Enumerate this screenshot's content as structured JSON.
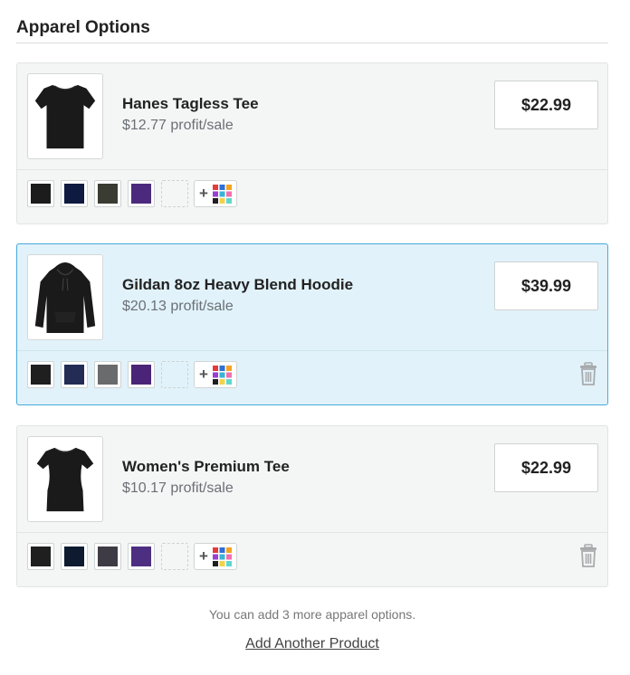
{
  "section": {
    "title": "Apparel Options"
  },
  "products": [
    {
      "name": "Hanes Tagless Tee",
      "profit": "$12.77 profit/sale",
      "price": "$22.99",
      "garment": "tee",
      "selected": false,
      "show_trash": false,
      "colors": [
        "#1c1c1c",
        "#0e1a3f",
        "#3a3c33",
        "#4b2a7d"
      ]
    },
    {
      "name": "Gildan 8oz Heavy Blend Hoodie",
      "profit": "$20.13 profit/sale",
      "price": "$39.99",
      "garment": "hoodie",
      "selected": true,
      "show_trash": true,
      "colors": [
        "#1f1f1f",
        "#222c55",
        "#6a6b6d",
        "#4a2577"
      ]
    },
    {
      "name": "Women's Premium Tee",
      "profit": "$10.17 profit/sale",
      "price": "$22.99",
      "garment": "womens-tee",
      "selected": false,
      "show_trash": true,
      "colors": [
        "#1f1f1f",
        "#0d1a30",
        "#3f3b44",
        "#4d2f82"
      ]
    }
  ],
  "icons": {
    "add_color": "plus-color-grid-icon",
    "delete": "trash-icon"
  },
  "palette_icon_colors": [
    "#e33b3b",
    "#2f6fd6",
    "#f2a324",
    "#9a3fd3",
    "#3ab4d6",
    "#f06fb0",
    "#1f1f1f",
    "#f3d24a",
    "#5fd6cf"
  ],
  "footer": {
    "note": "You can add 3 more apparel options.",
    "add_link": "Add Another Product"
  }
}
